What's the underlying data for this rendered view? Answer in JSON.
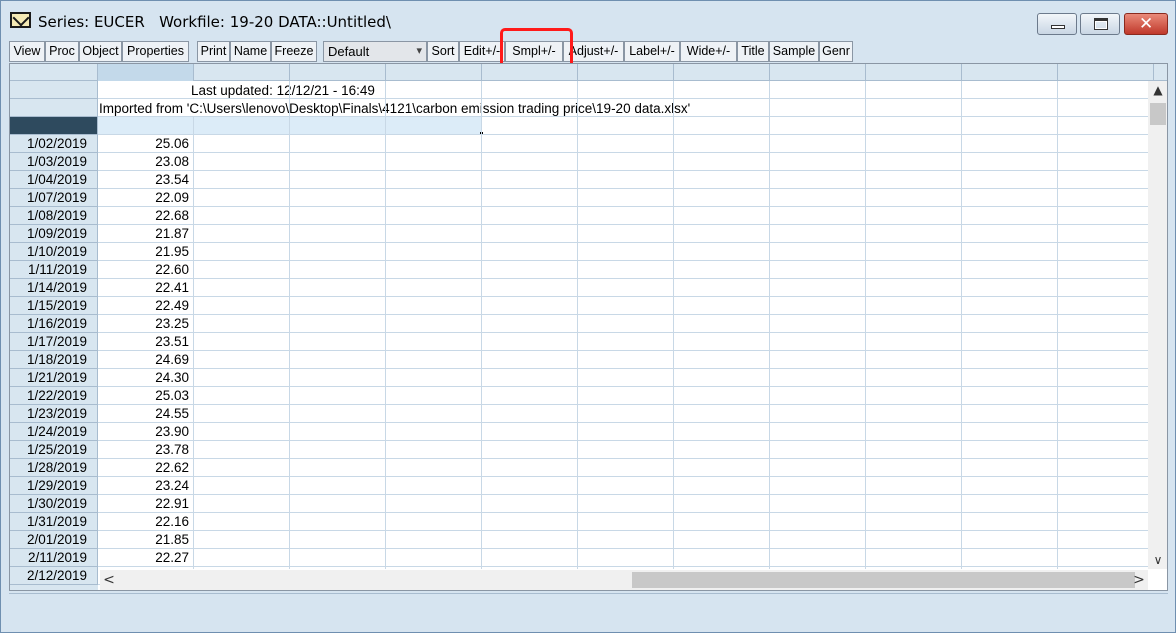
{
  "window": {
    "title": "Series: EUCER   Workfile: 19-20 DATA::Untitled\\"
  },
  "toolbar": {
    "buttons": [
      "View",
      "Proc",
      "Object",
      "Properties",
      "Print",
      "Name",
      "Freeze"
    ],
    "view_select": "Default",
    "buttons2": [
      "Sort",
      "Edit+/-",
      "Smpl+/-",
      "Adjust+/-",
      "Label+/-",
      "Wide+/-",
      "Title",
      "Sample",
      "Genr"
    ]
  },
  "sheet": {
    "last_updated": "Last updated: 12/12/21 - 16:49",
    "imported_from": "Imported from 'C:\\Users\\lenovo\\Desktop\\Finals\\4121\\carbon emission trading price\\19-20 data.xlsx'",
    "rows": [
      {
        "date": "1/02/2019",
        "value": "25.06"
      },
      {
        "date": "1/03/2019",
        "value": "23.08"
      },
      {
        "date": "1/04/2019",
        "value": "23.54"
      },
      {
        "date": "1/07/2019",
        "value": "22.09"
      },
      {
        "date": "1/08/2019",
        "value": "22.68"
      },
      {
        "date": "1/09/2019",
        "value": "21.87"
      },
      {
        "date": "1/10/2019",
        "value": "21.95"
      },
      {
        "date": "1/11/2019",
        "value": "22.60"
      },
      {
        "date": "1/14/2019",
        "value": "22.41"
      },
      {
        "date": "1/15/2019",
        "value": "22.49"
      },
      {
        "date": "1/16/2019",
        "value": "23.25"
      },
      {
        "date": "1/17/2019",
        "value": "23.51"
      },
      {
        "date": "1/18/2019",
        "value": "24.69"
      },
      {
        "date": "1/21/2019",
        "value": "24.30"
      },
      {
        "date": "1/22/2019",
        "value": "25.03"
      },
      {
        "date": "1/23/2019",
        "value": "24.55"
      },
      {
        "date": "1/24/2019",
        "value": "23.90"
      },
      {
        "date": "1/25/2019",
        "value": "23.78"
      },
      {
        "date": "1/28/2019",
        "value": "22.62"
      },
      {
        "date": "1/29/2019",
        "value": "23.24"
      },
      {
        "date": "1/30/2019",
        "value": "22.91"
      },
      {
        "date": "1/31/2019",
        "value": "22.16"
      },
      {
        "date": "2/01/2019",
        "value": "21.85"
      },
      {
        "date": "2/11/2019",
        "value": "22.27"
      },
      {
        "date": "2/12/2019",
        "value": ""
      }
    ]
  },
  "scrollbars": {
    "up_arrow": "▲",
    "down_arrow": "∨",
    "left_arrow": "<",
    "right_arrow": ">"
  }
}
